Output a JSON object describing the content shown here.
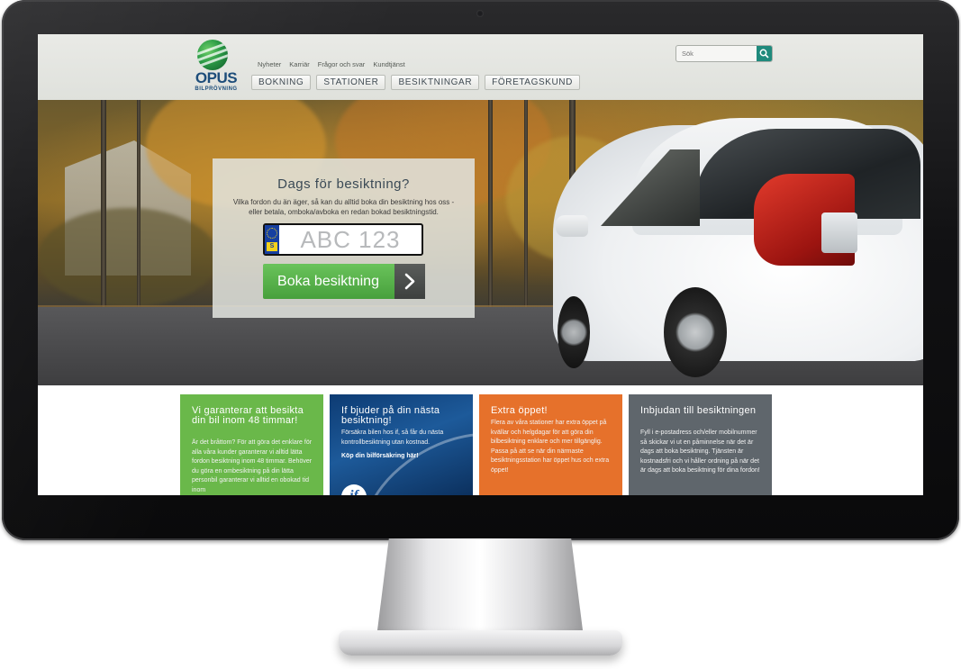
{
  "header": {
    "logo_text": "OPUS",
    "logo_sub": "BILPRÖVNING",
    "top_links": [
      "Nyheter",
      "Karriär",
      "Frågor och svar",
      "Kundtjänst"
    ],
    "nav": [
      "BOKNING",
      "STATIONER",
      "BESIKTNINGAR",
      "FÖRETAGSKUND"
    ],
    "search_placeholder": "Sök"
  },
  "hero": {
    "title": "Dags för besiktning?",
    "description": "Vilka fordon du än äger, så kan du alltid boka din besiktning hos oss - eller betala, omboka/avboka en redan bokad besiktningstid.",
    "plate_country": "S",
    "plate_placeholder": "ABC 123",
    "button_label": "Boka besiktning"
  },
  "cards": [
    {
      "title": "Vi garanterar att besikta din bil inom 48 timmar!",
      "text": "Är det bråttom? För att göra det enklare för alla våra kunder garanterar vi alltid lätta fordon besiktning inom 48 timmar. Behöver du göra en ombesiktning på din lätta personbil garanterar vi alltid en obokad tid inom",
      "color": "#6ab84a"
    },
    {
      "title": "If bjuder på din nästa besiktning!",
      "text": "Försäkra bilen hos if, så får du nästa kontrollbesiktning utan kostnad.",
      "link": "Köp din bilförsäkring här!",
      "logo": "if",
      "color": "#1d5a9a"
    },
    {
      "title": "Extra öppet!",
      "text": "Flera av våra stationer har extra öppet på kvällar och helgdagar för att göra din bilbesiktning enklare och mer tillgänglig. Passa på att se när din närmaste besiktningsstation har öppet hus och extra öppet!",
      "color": "#e6712b"
    },
    {
      "title": "Inbjudan till besiktningen",
      "text": "Fyll i e-postadress och/eller mobilnummer så skickar vi ut en påminnelse när det är dags att boka besiktning. Tjänsten är kostnadsfri och vi håller ordning på när det är dags att boka besiktning för dina fordon!",
      "color": "#5f666c"
    }
  ]
}
